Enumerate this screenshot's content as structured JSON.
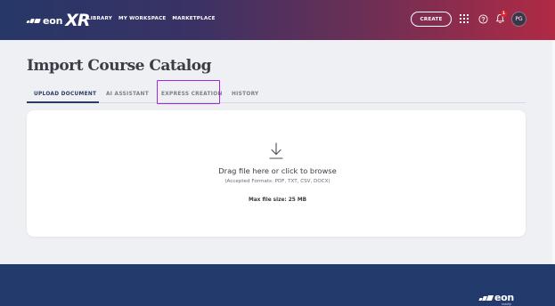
{
  "header": {
    "logo": {
      "brand": "eon",
      "product": "XR"
    },
    "nav": [
      {
        "label": "LIBRARY"
      },
      {
        "label": "MY WORKSPACE"
      },
      {
        "label": "MARKETPLACE"
      }
    ],
    "create_label": "CREATE",
    "icons": [
      "apps-grid-icon",
      "help-icon",
      "bell-icon"
    ],
    "notification_count": "1",
    "avatar_initials": "PG"
  },
  "page": {
    "title": "Import Course Catalog",
    "tabs": [
      {
        "label": "UPLOAD DOCUMENT",
        "active": true
      },
      {
        "label": "AI ASSISTANT",
        "active": false
      },
      {
        "label": "EXPRESS CREATION",
        "active": false,
        "highlighted": true
      },
      {
        "label": "HISTORY",
        "active": false
      }
    ]
  },
  "upload": {
    "icon": "download-arrow-icon",
    "prompt": "Drag file here or click to browse",
    "formats": "(Accepted Formats: PDF, TXT, CSV, DOCX)",
    "max_size": "Max file size: 25 MB"
  },
  "footer": {
    "logo": {
      "brand": "eon",
      "sub": "reality"
    }
  },
  "colors": {
    "header_gradient_start": "#263768",
    "header_gradient_end": "#b02a44",
    "active_tab": "#2a3b66",
    "highlight_border": "#a427e8",
    "footer_bg": "#223a6c",
    "badge": "#e2262d"
  }
}
